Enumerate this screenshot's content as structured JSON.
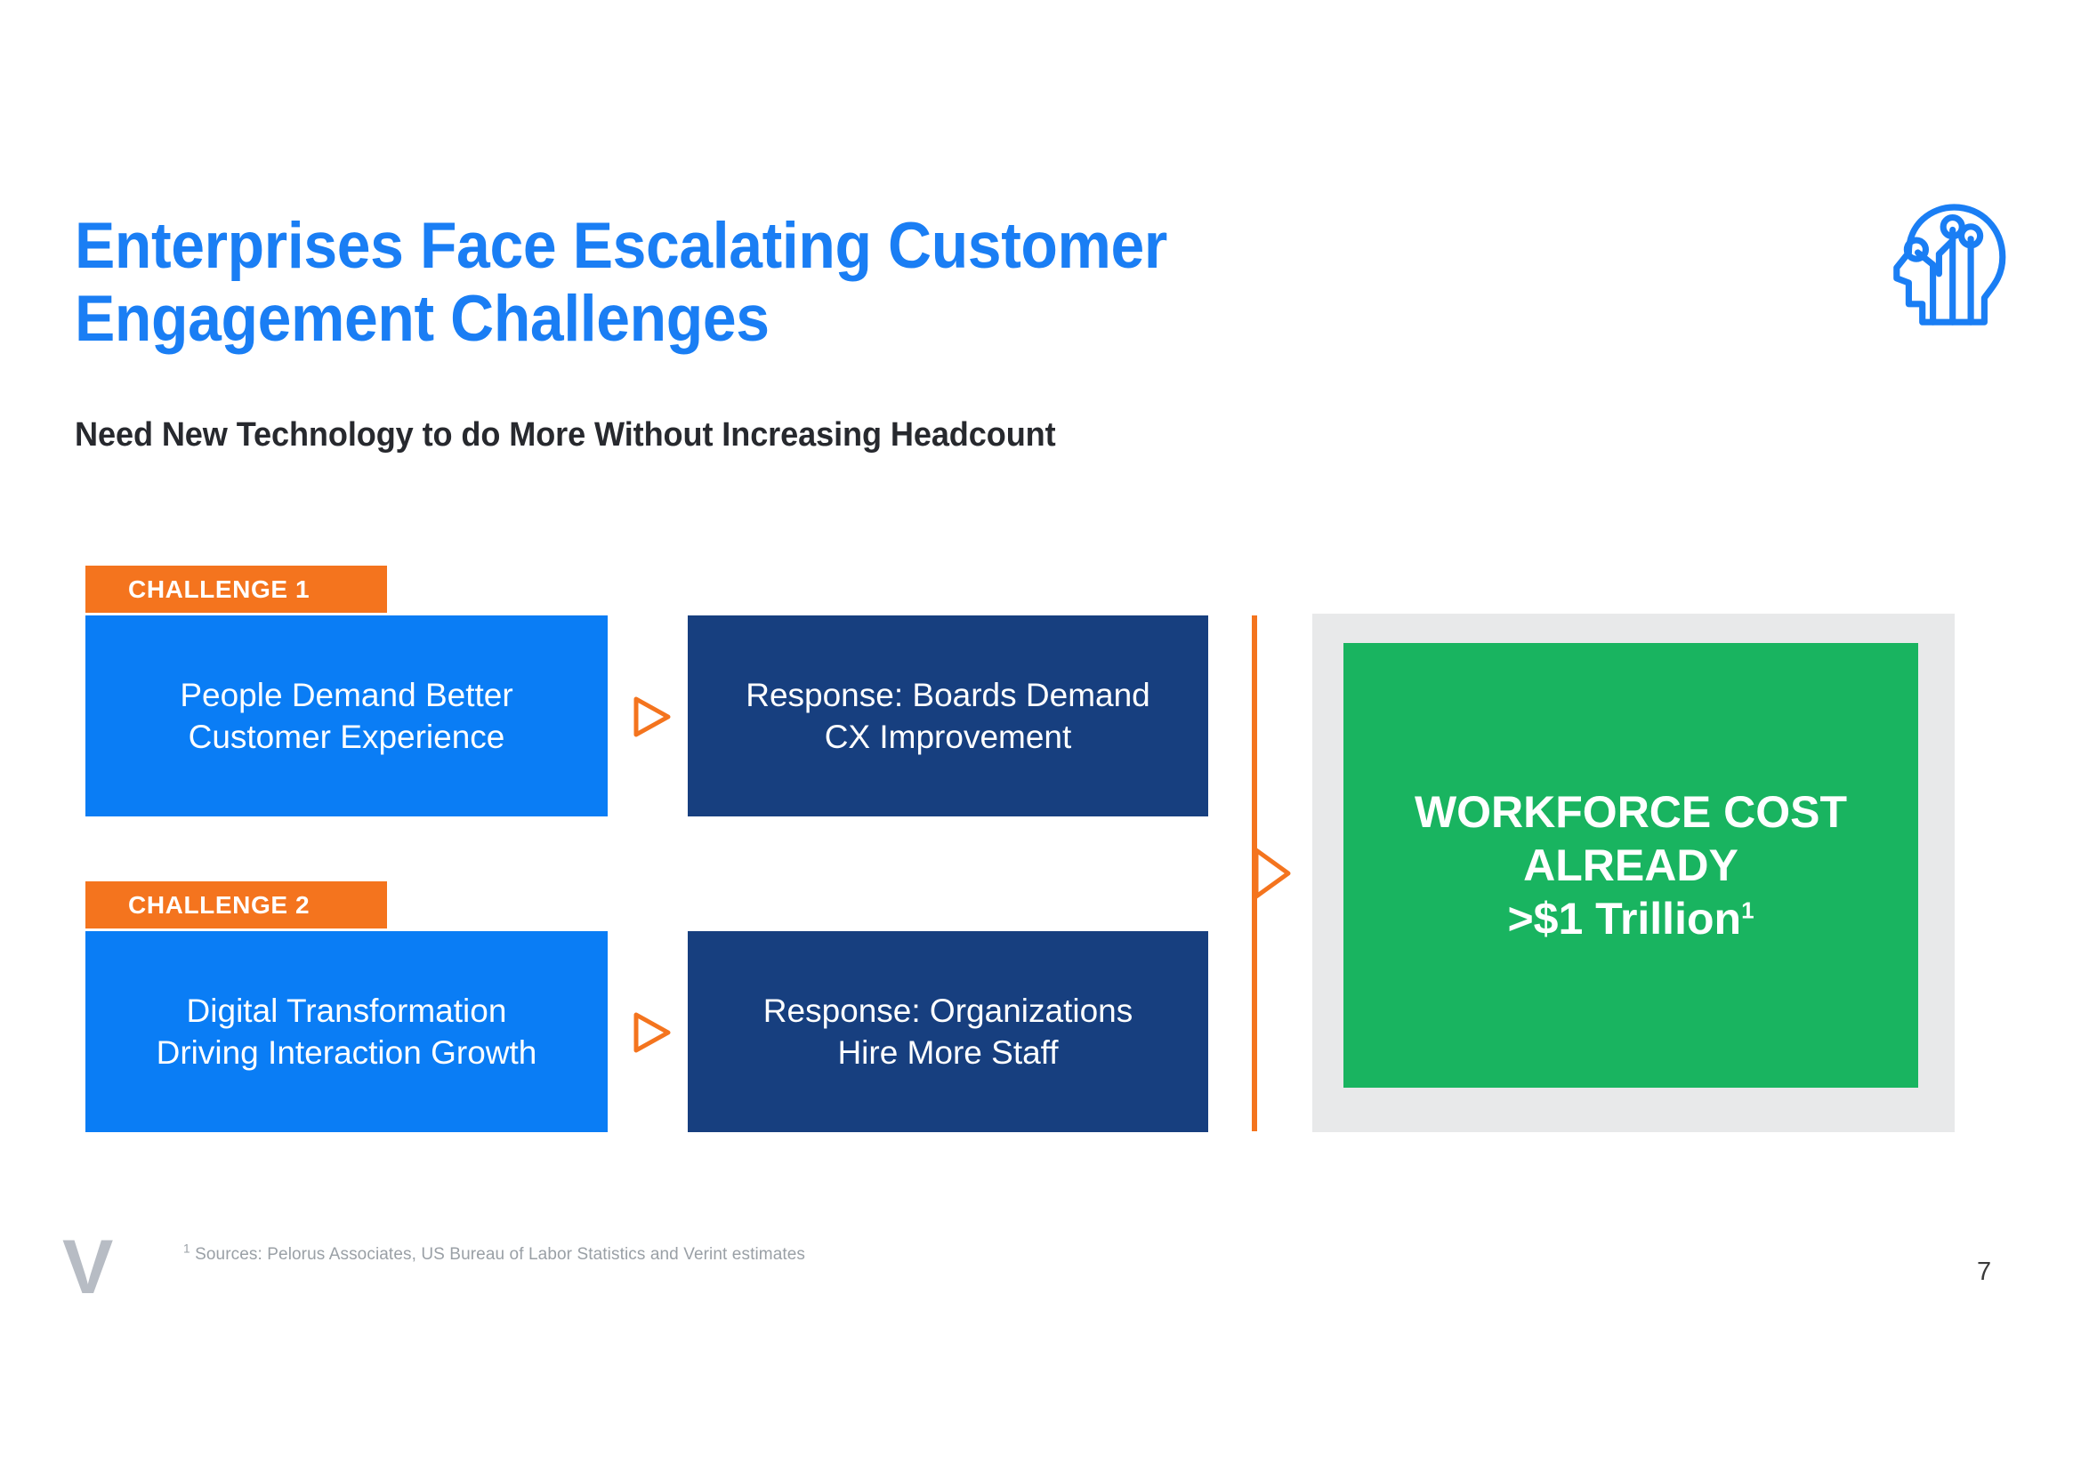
{
  "slide": {
    "title": "Enterprises Face Escalating Customer Engagement Challenges",
    "subtitle": "Need New Technology to do More Without Increasing Headcount",
    "page_number": "7",
    "logo_letter": "V",
    "icon_name": "ai-head-circuit-icon",
    "colors": {
      "title_blue": "#1a7ef4",
      "accent_orange": "#f4741e",
      "box_blue": "#0a7df5",
      "box_navy": "#173f7f",
      "panel_green": "#19b460",
      "frame_gray": "#e8e9ea",
      "subtitle_dark": "#27292e"
    }
  },
  "diagram": {
    "rows": [
      {
        "badge": "CHALLENGE 1",
        "challenge": "People Demand Better Customer Experience",
        "challenge_lines": [
          "People Demand Better",
          "Customer Experience"
        ],
        "response": "Response: Boards Demand CX Improvement",
        "response_lines": [
          "Response: Boards Demand",
          "CX Improvement"
        ],
        "arrow": "triangle-right-icon"
      },
      {
        "badge": "CHALLENGE 2",
        "challenge": "Digital Transformation Driving Interaction Growth",
        "challenge_lines": [
          "Digital Transformation",
          "Driving Interaction Growth"
        ],
        "response": "Response: Organizations Hire More Staff",
        "response_lines": [
          "Response: Organizations",
          "Hire More Staff"
        ],
        "arrow": "triangle-right-icon"
      }
    ],
    "divider_arrow": "triangle-right-outline-icon",
    "outcome": {
      "line1": "WORKFORCE COST",
      "line2": "ALREADY",
      "line3": ">$1 Trillion",
      "footnote_marker": "1"
    }
  },
  "footer": {
    "footnote_marker": "1",
    "footnote": " Sources: Pelorus Associates, US Bureau of Labor Statistics and Verint estimates"
  }
}
